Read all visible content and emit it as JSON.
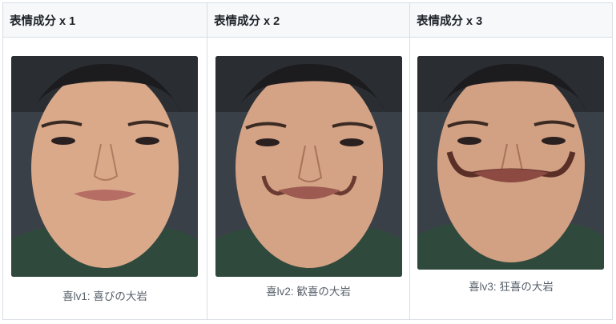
{
  "columns": [
    {
      "header": "表情成分 x 1",
      "caption": "喜lv1: 喜びの大岩"
    },
    {
      "header": "表情成分 x 2",
      "caption": "喜lv2: 歓喜の大岩"
    },
    {
      "header": "表情成分 x 3",
      "caption": "喜lv3: 狂喜の大岩"
    }
  ],
  "colors": {
    "border": "#d9dde3",
    "header_bg": "#f6f8fa",
    "caption_text": "#57606a"
  }
}
